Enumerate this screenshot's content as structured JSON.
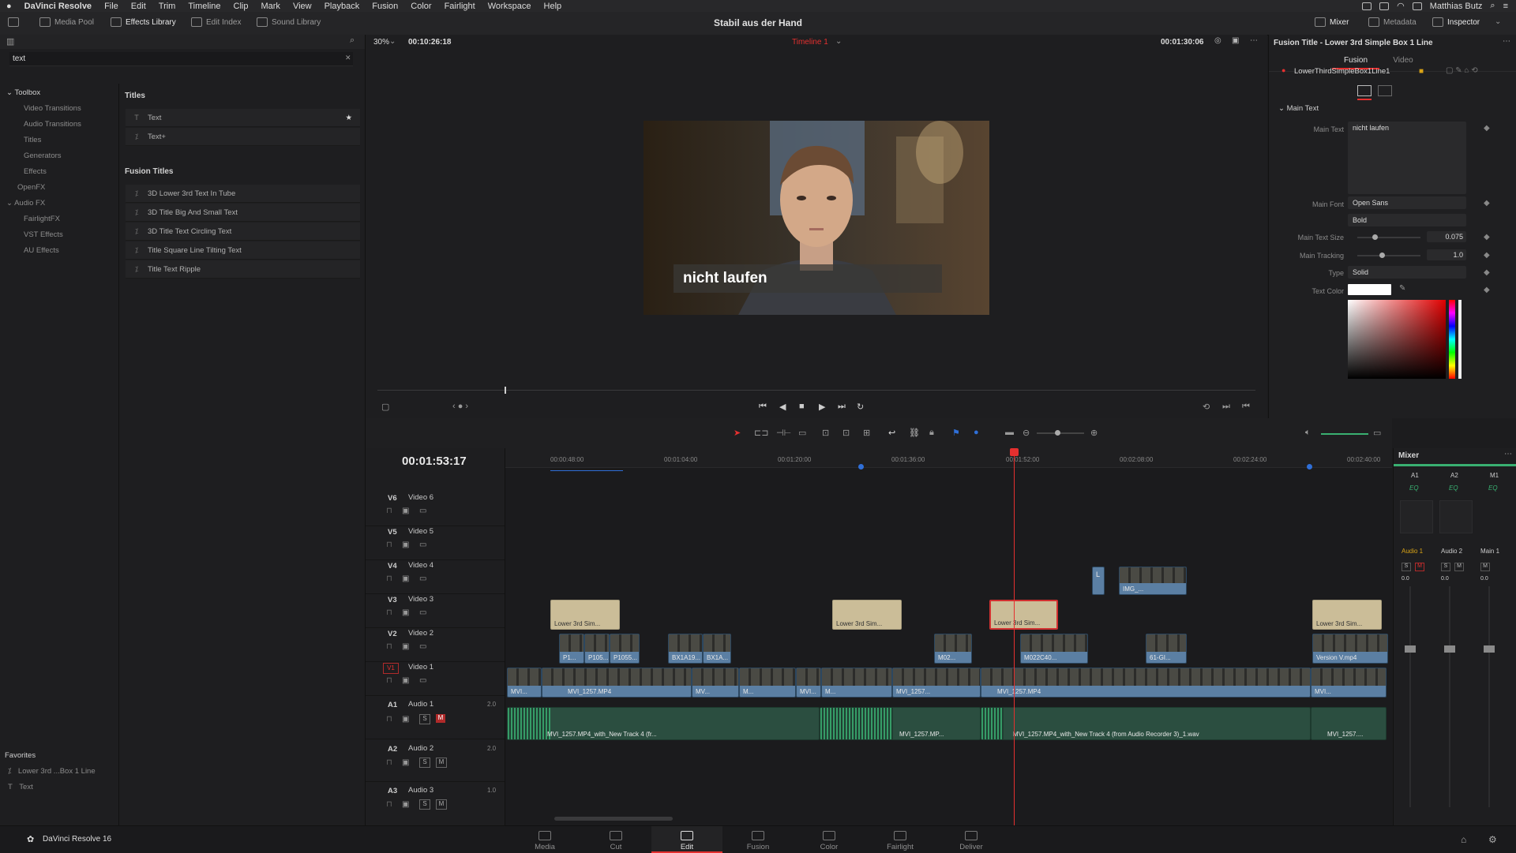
{
  "menubar": {
    "app_name": "DaVinci Resolve",
    "menus": [
      "File",
      "Edit",
      "Trim",
      "Timeline",
      "Clip",
      "Mark",
      "View",
      "Playback",
      "Fusion",
      "Color",
      "Fairlight",
      "Workspace",
      "Help"
    ],
    "user": "Matthias Butz"
  },
  "toolbar": {
    "media_pool": "Media Pool",
    "effects_library": "Effects Library",
    "edit_index": "Edit Index",
    "sound_library": "Sound Library",
    "project_title": "Stabil aus der Hand",
    "mixer": "Mixer",
    "metadata": "Metadata",
    "inspector": "Inspector"
  },
  "effects": {
    "search_value": "text",
    "toolbox_label": "Toolbox",
    "toolbox_items": [
      "Video Transitions",
      "Audio Transitions",
      "Titles",
      "Generators",
      "Effects"
    ],
    "openfx": "OpenFX",
    "audiofx": "Audio FX",
    "audiofx_items": [
      "FairlightFX",
      "VST Effects",
      "AU Effects"
    ],
    "titles_header": "Titles",
    "titles": [
      "Text",
      "Text+"
    ],
    "fusion_titles_header": "Fusion Titles",
    "fusion_titles": [
      "3D Lower 3rd Text In Tube",
      "3D Title Big And Small Text",
      "3D Title Text Circling Text",
      "Title Square Line Tilting Text",
      "Title Text Ripple"
    ],
    "favorites_header": "Favorites",
    "favorites": [
      "Lower 3rd ...Box 1 Line",
      "Text"
    ]
  },
  "viewer": {
    "zoom": "30%",
    "source_timecode": "00:10:26:18",
    "timeline_name": "Timeline 1",
    "record_timecode": "00:01:30:06",
    "overlay_text": "nicht laufen"
  },
  "inspector": {
    "title": "Fusion Title - Lower 3rd Simple Box 1 Line",
    "tab_fusion": "Fusion",
    "tab_video": "Video",
    "node_name": "LowerThirdSimpleBox1Line1",
    "section": "Main Text",
    "main_text_label": "Main Text",
    "main_text_value": "nicht laufen",
    "main_font_label": "Main Font",
    "main_font_value": "Open Sans",
    "font_style_value": "Bold",
    "text_size_label": "Main Text Size",
    "text_size_value": "0.075",
    "tracking_label": "Main Tracking",
    "tracking_value": "1.0",
    "type_label": "Type",
    "type_value": "Solid",
    "text_color_label": "Text Color",
    "text_color": "#ffffff"
  },
  "timeline": {
    "timecode": "00:01:53:17",
    "ruler": [
      "00:00:48:00",
      "00:01:04:00",
      "00:01:20:00",
      "00:01:36:00",
      "00:01:52:00",
      "00:02:08:00",
      "00:02:24:00",
      "00:02:40:00"
    ],
    "tracks": [
      {
        "id": "V6",
        "name": "Video 6"
      },
      {
        "id": "V5",
        "name": "Video 5"
      },
      {
        "id": "V4",
        "name": "Video 4"
      },
      {
        "id": "V3",
        "name": "Video 3"
      },
      {
        "id": "V2",
        "name": "Video 2"
      },
      {
        "id": "V1",
        "name": "Video 1"
      },
      {
        "id": "A1",
        "name": "Audio 1",
        "level": "2.0"
      },
      {
        "id": "A2",
        "name": "Audio 2",
        "level": "2.0"
      },
      {
        "id": "A3",
        "name": "Audio 3",
        "level": "1.0"
      }
    ],
    "clips": {
      "v4_a": "L",
      "v4_b": "IMG_...",
      "v3": [
        "Lower 3rd Sim...",
        "Lower 3rd Sim...",
        "Lower 3rd Sim...",
        "Lower 3rd Sim..."
      ],
      "v2": [
        "P1...",
        "P105...",
        "P1055...",
        "BX1A19...",
        "BX1A...",
        "M02...",
        "M022C40...",
        "61-GI...",
        "Version V.mp4"
      ],
      "v1": [
        "MVI...",
        "MVI_1257.MP4",
        "MV...",
        "M...",
        "MVI...",
        "M...",
        "MVI_1257...",
        "MVI_1257.MP4",
        "MVI..."
      ],
      "a1": [
        "MVI_1257.MP4_with_New Track 4 (fr...",
        "MVI_1257.MP...",
        "MVI_1257.MP4_with_New Track 4 (from Audio Recorder 3)_1.wav",
        "MVI_1257...."
      ]
    }
  },
  "mixer": {
    "title": "Mixer",
    "channels": [
      "A1",
      "A2",
      "M1"
    ],
    "eq": "EQ",
    "strips": [
      "Audio 1",
      "Audio 2",
      "Main 1"
    ],
    "values": [
      "0.0",
      "0.0",
      "0.0"
    ]
  },
  "pages": {
    "brand": "DaVinci Resolve 16",
    "items": [
      "Media",
      "Cut",
      "Edit",
      "Fusion",
      "Color",
      "Fairlight",
      "Deliver"
    ],
    "active": "Edit"
  },
  "colors": {
    "accent_red": "#e5302f",
    "title_clip": "#cbbd98",
    "video_clip": "#5b7fa3",
    "audio_clip": "#2b4e40"
  }
}
